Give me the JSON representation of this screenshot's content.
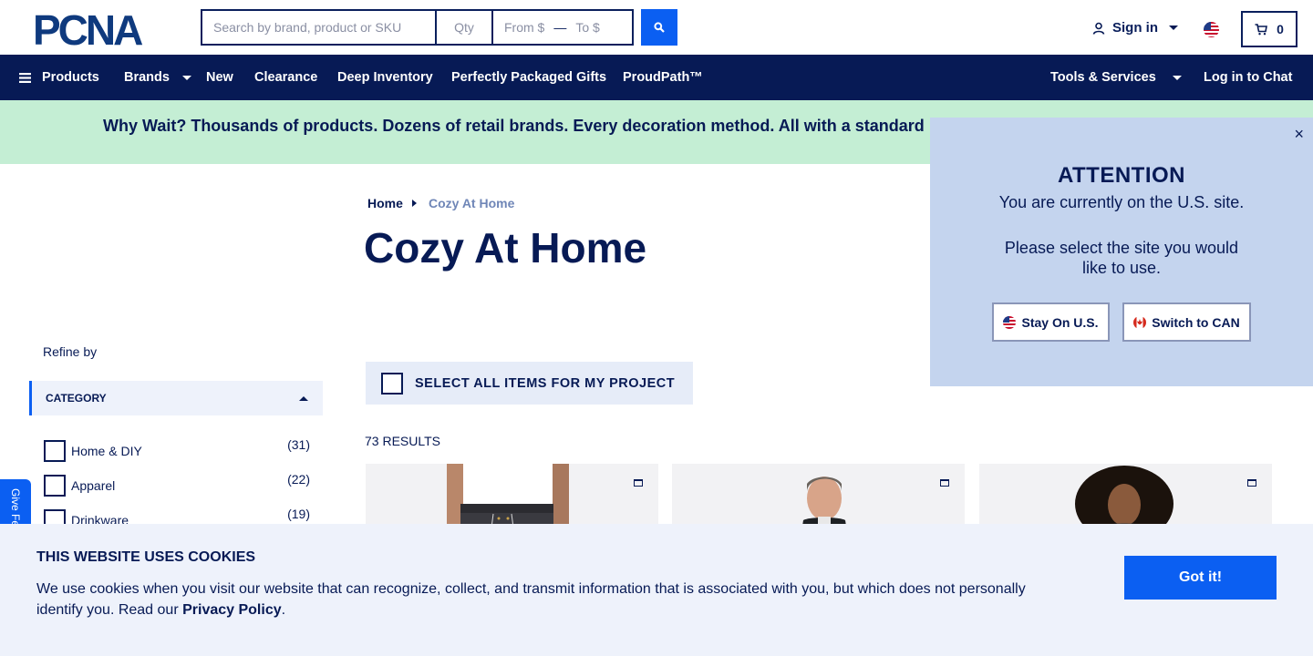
{
  "header": {
    "logo_text": "PCNA",
    "search_placeholder": "Search by brand, product or SKU",
    "qty_placeholder": "Qty",
    "from_placeholder": "From $",
    "range_separator": "—",
    "to_placeholder": "To $",
    "signin_label": "Sign in",
    "cart_count": "0",
    "accent_color": "#0b5ff2",
    "navy_color": "#071a55"
  },
  "nav": {
    "products": "Products",
    "brands": "Brands",
    "new": "New",
    "clearance": "Clearance",
    "deep_inventory": "Deep Inventory",
    "gifts": "Perfectly Packaged Gifts",
    "proudpath": "ProudPath™",
    "tools": "Tools & Services",
    "chat": "Log in to Chat"
  },
  "banner": {
    "text": "Why Wait? Thousands of products. Dozens of retail brands. Every decoration method. All with a standard",
    "bg_color": "#c4eed4"
  },
  "breadcrumb": {
    "home": "Home",
    "current": "Cozy At Home"
  },
  "page_title": "Cozy At Home",
  "sidebar": {
    "refine_label": "Refine by",
    "category_label": "CATEGORY",
    "items": [
      {
        "label": "Home & DIY",
        "count": "(31)"
      },
      {
        "label": "Apparel",
        "count": "(22)"
      },
      {
        "label": "Drinkware",
        "count": "(19)"
      }
    ],
    "feedback_label": "Give Feedback"
  },
  "main": {
    "select_all_label": "SELECT ALL ITEMS FOR MY PROJECT",
    "results_label": "73 RESULTS"
  },
  "attention": {
    "close": "×",
    "title": "ATTENTION",
    "line1": "You are currently on the U.S. site.",
    "line2": "Please select the site you would like to use.",
    "stay_label": "Stay On U.S.",
    "switch_label": "Switch to CAN",
    "bg_color": "#c4d4ee"
  },
  "cookie": {
    "title": "THIS WEBSITE USES COOKIES",
    "text_before": "We use cookies when you visit our website that can recognize, collect, and transmit information that is associated with you, but which does not personally identify you. Read our ",
    "link": "Privacy Policy",
    "text_after": ".",
    "button": "Got it!"
  }
}
